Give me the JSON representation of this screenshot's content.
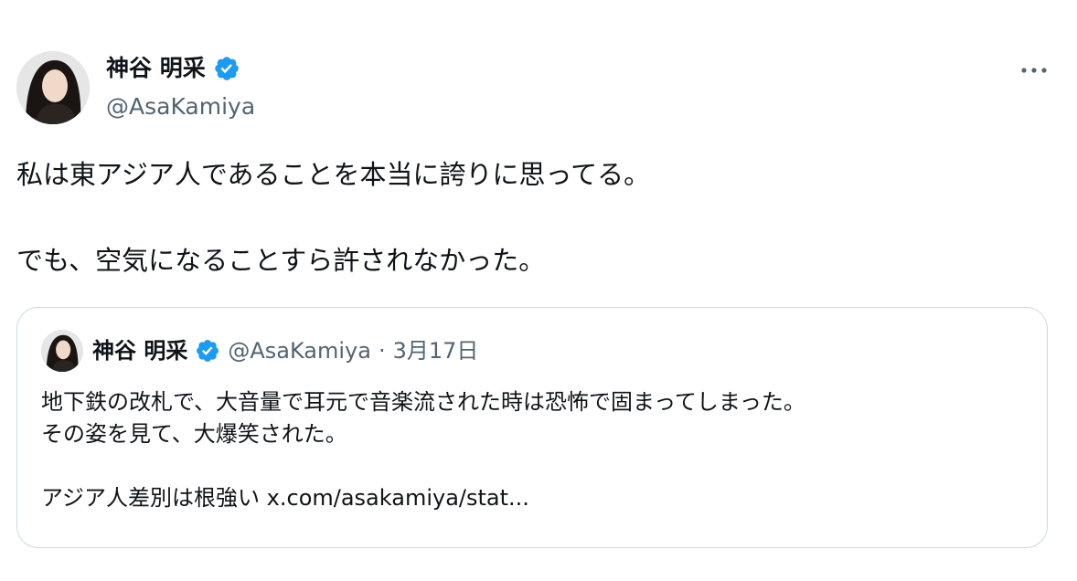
{
  "tweet": {
    "author": {
      "display_name": "神谷 明采",
      "handle": "@AsaKamiya",
      "verified": true
    },
    "more_icon": "more-horizontal-icon",
    "text": "私は東アジア人であることを本当に誇りに思ってる。\n\nでも、空気になることすら許されなかった。"
  },
  "quoted_tweet": {
    "author": {
      "display_name": "神谷 明采",
      "handle": "@AsaKamiya",
      "verified": true
    },
    "separator": "·",
    "date": "3月17日",
    "lines": [
      "地下鉄の改札で、大音量で耳元で音楽流された時は恐怖で固まってしまった。",
      "その姿を見て、大爆笑された。"
    ],
    "last_line_text": "アジア人差別は根強い ",
    "link_text": "x.com/asakamiya/stat..."
  },
  "colors": {
    "text": "#0f1419",
    "secondary": "#536471",
    "verified_badge": "#1d9bf0",
    "border": "#cfd9de"
  }
}
